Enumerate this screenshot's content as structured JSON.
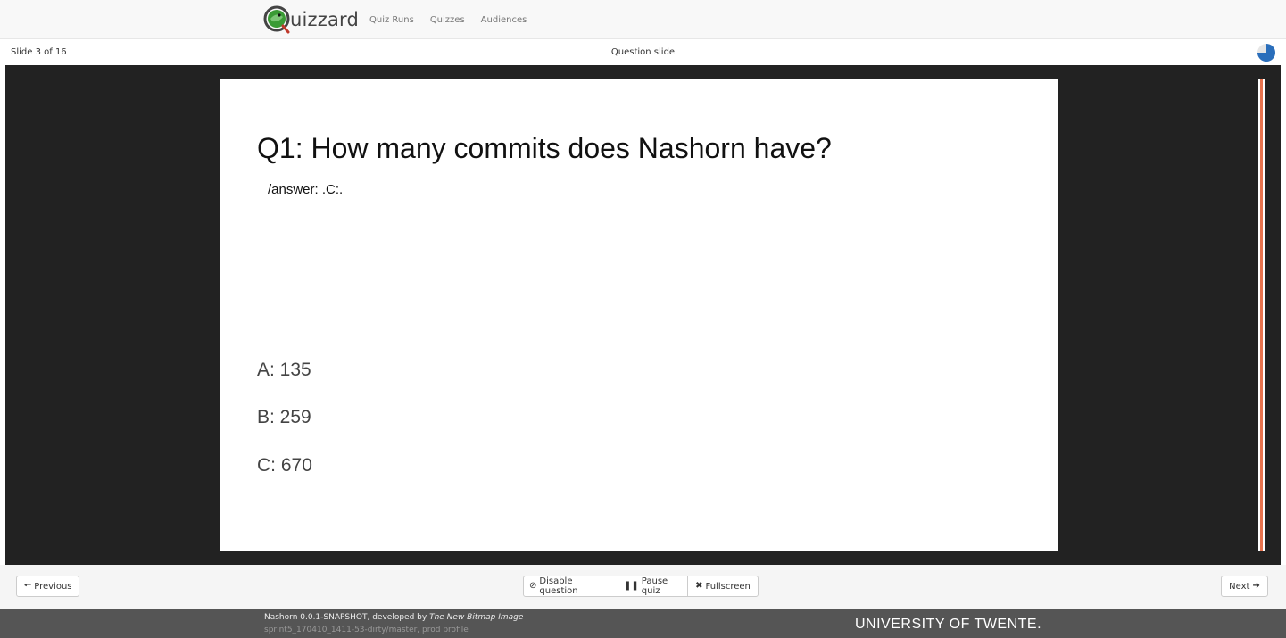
{
  "app": {
    "brand": "uizzard",
    "nav": [
      "Quiz Runs",
      "Quizzes",
      "Audiences"
    ]
  },
  "subheader": {
    "slide_counter": "Slide 3 of 16",
    "slide_type": "Question slide",
    "timer_remaining_fraction": 0.75
  },
  "slide": {
    "question": "Q1: How many commits does Nashorn have?",
    "answer_hint": "/answer: .C:.",
    "options": [
      "A: 135",
      "B: 259",
      "C: 670"
    ]
  },
  "controls": {
    "previous": "Previous",
    "disable_question": "Disable question",
    "pause_quiz": "Pause quiz",
    "fullscreen": "Fullscreen",
    "next": "Next"
  },
  "footer": {
    "version_prefix": "Nashorn 0.0.1-SNAPSHOT, developed by",
    "developer": "The New Bitmap Image",
    "build": "sprint5_170410_1411-53-dirty/master, prod profile",
    "university": "UNIVERSITY OF TWENTE."
  },
  "colors": {
    "accent_progress": "#e8734e",
    "timer_blue": "#2a6ebb",
    "logo_green": "#3a9b35"
  },
  "icons": {
    "previous": "arrow-left-icon",
    "next": "arrow-right-icon",
    "disable": "ban-icon",
    "pause": "pause-icon",
    "fullscreen": "fullscreen-icon"
  }
}
